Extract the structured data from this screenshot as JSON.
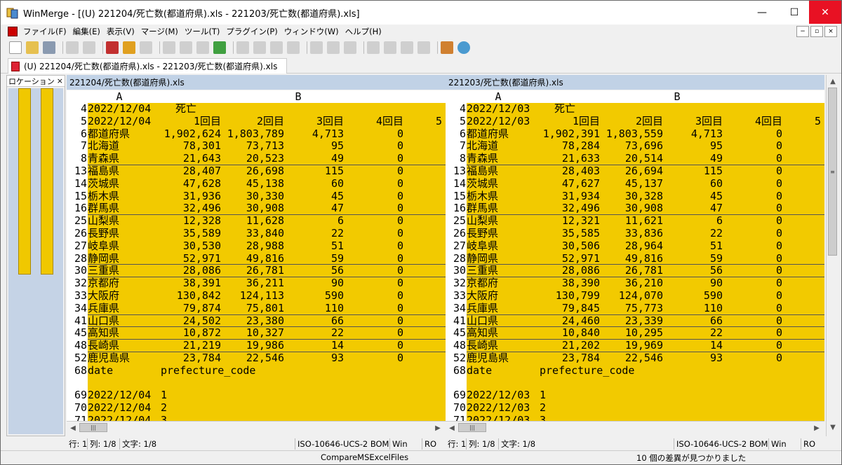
{
  "window": {
    "title": "WinMerge - [(U) 221204/死亡数(都道府県).xls - 221203/死亡数(都道府県).xls]",
    "minimize": "—",
    "maximize": "☐",
    "close": "✕"
  },
  "menu": [
    "ファイル(F)",
    "編集(E)",
    "表示(V)",
    "マージ(M)",
    "ツール(T)",
    "プラグイン(P)",
    "ウィンドウ(W)",
    "ヘルプ(H)"
  ],
  "mdi": {
    "minimize": "−",
    "restore": "▫",
    "close": "×"
  },
  "tab": {
    "label": "(U) 221204/死亡数(都道府県).xls - 221203/死亡数(都道府県).xls"
  },
  "location": {
    "label": "ロケーション ペイン",
    "close": "×"
  },
  "left": {
    "header": "221204/死亡数(都道府県).xls",
    "col_a": "A",
    "col_b": "B",
    "rows": [
      {
        "n": "4",
        "a": "2022/12/04",
        "b": [
          "死亡",
          "",
          "",
          "",
          ""
        ],
        "u": false
      },
      {
        "n": "5",
        "a": "2022/12/04",
        "b": [
          "1回目",
          "2回目",
          "3回目",
          "4回目",
          "5"
        ],
        "u": false
      },
      {
        "n": "6",
        "a": "都道府県",
        "b": [
          "1,902,624",
          "1,803,789",
          "4,713",
          "0",
          ""
        ],
        "u": false
      },
      {
        "n": "7",
        "a": "北海道",
        "b": [
          "78,301",
          "73,713",
          "95",
          "0",
          ""
        ],
        "u": false
      },
      {
        "n": "8",
        "a": "青森県",
        "b": [
          "21,643",
          "20,523",
          "49",
          "0",
          ""
        ],
        "u": true
      },
      {
        "n": "13",
        "a": "福島県",
        "b": [
          "28,407",
          "26,698",
          "115",
          "0",
          ""
        ],
        "u": false
      },
      {
        "n": "14",
        "a": "茨城県",
        "b": [
          "47,628",
          "45,138",
          "60",
          "0",
          ""
        ],
        "u": false
      },
      {
        "n": "15",
        "a": "栃木県",
        "b": [
          "31,936",
          "30,330",
          "45",
          "0",
          ""
        ],
        "u": false
      },
      {
        "n": "16",
        "a": "群馬県",
        "b": [
          "32,496",
          "30,908",
          "47",
          "0",
          ""
        ],
        "u": true
      },
      {
        "n": "25",
        "a": "山梨県",
        "b": [
          "12,328",
          "11,628",
          "6",
          "0",
          ""
        ],
        "u": false
      },
      {
        "n": "26",
        "a": "長野県",
        "b": [
          "35,589",
          "33,840",
          "22",
          "0",
          ""
        ],
        "u": false
      },
      {
        "n": "27",
        "a": "岐阜県",
        "b": [
          "30,530",
          "28,988",
          "51",
          "0",
          ""
        ],
        "u": false
      },
      {
        "n": "28",
        "a": "静岡県",
        "b": [
          "52,971",
          "49,816",
          "59",
          "0",
          ""
        ],
        "u": true
      },
      {
        "n": "30",
        "a": "三重県",
        "b": [
          "28,086",
          "26,781",
          "56",
          "0",
          ""
        ],
        "u": true
      },
      {
        "n": "32",
        "a": "京都府",
        "b": [
          "38,391",
          "36,211",
          "90",
          "0",
          ""
        ],
        "u": false
      },
      {
        "n": "33",
        "a": "大阪府",
        "b": [
          "130,842",
          "124,113",
          "590",
          "0",
          ""
        ],
        "u": false
      },
      {
        "n": "34",
        "a": "兵庫県",
        "b": [
          "79,874",
          "75,801",
          "110",
          "0",
          ""
        ],
        "u": true
      },
      {
        "n": "41",
        "a": "山口県",
        "b": [
          "24,502",
          "23,380",
          "66",
          "0",
          ""
        ],
        "u": true
      },
      {
        "n": "45",
        "a": "高知県",
        "b": [
          "10,872",
          "10,327",
          "22",
          "0",
          ""
        ],
        "u": true
      },
      {
        "n": "48",
        "a": "長崎県",
        "b": [
          "21,219",
          "19,986",
          "14",
          "0",
          ""
        ],
        "u": true
      },
      {
        "n": "52",
        "a": "鹿児島県",
        "b": [
          "23,784",
          "22,546",
          "93",
          "0",
          ""
        ],
        "u": false
      }
    ],
    "tail": [
      {
        "n": "68",
        "a": "date",
        "b": "prefecture_code"
      },
      {
        "n": "",
        "a": "",
        "b": ""
      },
      {
        "n": "69",
        "a": "2022/12/04",
        "b": "1"
      },
      {
        "n": "70",
        "a": "2022/12/04",
        "b": "2"
      },
      {
        "n": "71",
        "a": "2022/12/04",
        "b": "3"
      }
    ],
    "status": [
      "行: 1",
      "列: 1/8",
      "文字: 1/8",
      "ISO-10646-UCS-2 BOM",
      "Win",
      "RO"
    ]
  },
  "right": {
    "header": "221203/死亡数(都道府県).xls",
    "col_a": "A",
    "col_b": "B",
    "rows": [
      {
        "n": "4",
        "a": "2022/12/03",
        "b": [
          "死亡",
          "",
          "",
          "",
          ""
        ],
        "u": false
      },
      {
        "n": "5",
        "a": "2022/12/03",
        "b": [
          "1回目",
          "2回目",
          "3回目",
          "4回目",
          "5"
        ],
        "u": false
      },
      {
        "n": "6",
        "a": "都道府県",
        "b": [
          "1,902,391",
          "1,803,559",
          "4,713",
          "0",
          ""
        ],
        "u": false
      },
      {
        "n": "7",
        "a": "北海道",
        "b": [
          "78,284",
          "73,696",
          "95",
          "0",
          ""
        ],
        "u": false
      },
      {
        "n": "8",
        "a": "青森県",
        "b": [
          "21,633",
          "20,514",
          "49",
          "0",
          ""
        ],
        "u": true
      },
      {
        "n": "13",
        "a": "福島県",
        "b": [
          "28,403",
          "26,694",
          "115",
          "0",
          ""
        ],
        "u": false
      },
      {
        "n": "14",
        "a": "茨城県",
        "b": [
          "47,627",
          "45,137",
          "60",
          "0",
          ""
        ],
        "u": false
      },
      {
        "n": "15",
        "a": "栃木県",
        "b": [
          "31,934",
          "30,328",
          "45",
          "0",
          ""
        ],
        "u": false
      },
      {
        "n": "16",
        "a": "群馬県",
        "b": [
          "32,496",
          "30,908",
          "47",
          "0",
          ""
        ],
        "u": true
      },
      {
        "n": "25",
        "a": "山梨県",
        "b": [
          "12,321",
          "11,621",
          "6",
          "0",
          ""
        ],
        "u": false
      },
      {
        "n": "26",
        "a": "長野県",
        "b": [
          "35,585",
          "33,836",
          "22",
          "0",
          ""
        ],
        "u": false
      },
      {
        "n": "27",
        "a": "岐阜県",
        "b": [
          "30,506",
          "28,964",
          "51",
          "0",
          ""
        ],
        "u": false
      },
      {
        "n": "28",
        "a": "静岡県",
        "b": [
          "52,971",
          "49,816",
          "59",
          "0",
          ""
        ],
        "u": true
      },
      {
        "n": "30",
        "a": "三重県",
        "b": [
          "28,086",
          "26,781",
          "56",
          "0",
          ""
        ],
        "u": true
      },
      {
        "n": "32",
        "a": "京都府",
        "b": [
          "38,390",
          "36,210",
          "90",
          "0",
          ""
        ],
        "u": false
      },
      {
        "n": "33",
        "a": "大阪府",
        "b": [
          "130,799",
          "124,070",
          "590",
          "0",
          ""
        ],
        "u": false
      },
      {
        "n": "34",
        "a": "兵庫県",
        "b": [
          "79,845",
          "75,773",
          "110",
          "0",
          ""
        ],
        "u": true
      },
      {
        "n": "41",
        "a": "山口県",
        "b": [
          "24,460",
          "23,339",
          "66",
          "0",
          ""
        ],
        "u": true
      },
      {
        "n": "45",
        "a": "高知県",
        "b": [
          "10,840",
          "10,295",
          "22",
          "0",
          ""
        ],
        "u": true
      },
      {
        "n": "48",
        "a": "長崎県",
        "b": [
          "21,202",
          "19,969",
          "14",
          "0",
          ""
        ],
        "u": true
      },
      {
        "n": "52",
        "a": "鹿児島県",
        "b": [
          "23,784",
          "22,546",
          "93",
          "0",
          ""
        ],
        "u": false
      }
    ],
    "tail": [
      {
        "n": "68",
        "a": "date",
        "b": "prefecture_code"
      },
      {
        "n": "",
        "a": "",
        "b": ""
      },
      {
        "n": "69",
        "a": "2022/12/03",
        "b": "1"
      },
      {
        "n": "70",
        "a": "2022/12/03",
        "b": "2"
      },
      {
        "n": "71",
        "a": "2022/12/03",
        "b": "3"
      }
    ],
    "status": [
      "行: 1",
      "列: 1/8",
      "文字: 1/8",
      "ISO-10646-UCS-2 BOM",
      "Win",
      "RO"
    ]
  },
  "statusbar": {
    "plugin": "CompareMSExcelFiles",
    "diffs": "10 個の差異が見つかりました"
  },
  "colors": {
    "diff": "#f2ca00",
    "header": "#c1d2e6",
    "close": "#e81123"
  }
}
